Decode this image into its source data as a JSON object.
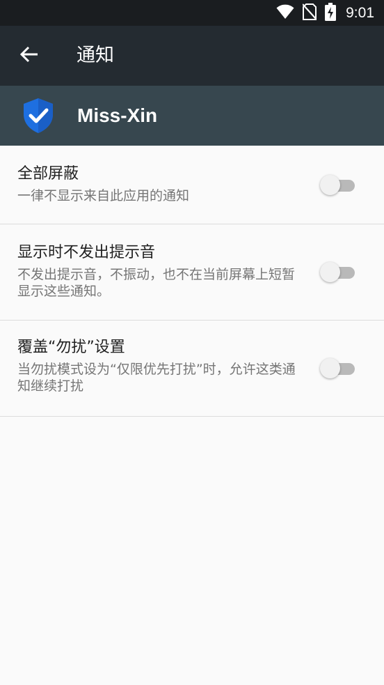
{
  "status_bar": {
    "time": "9:01",
    "icons": [
      "wifi-icon",
      "no-sim-icon",
      "battery-charging-icon"
    ]
  },
  "toolbar": {
    "back_icon": "arrow-left-icon",
    "title": "通知"
  },
  "app_header": {
    "icon": "shield-check-icon",
    "name": "Miss-Xin",
    "icon_color": "#1e6fe0"
  },
  "settings": [
    {
      "title": "全部屏蔽",
      "summary": "一律不显示来自此应用的通知",
      "enabled": false
    },
    {
      "title": "显示时不发出提示音",
      "summary": "不发出提示音，不振动，也不在当前屏幕上短暂显示这些通知。",
      "enabled": false
    },
    {
      "title": "覆盖“勿扰”设置",
      "summary": "当勿扰模式设为“仅限优先打扰”时，允许这类通知继续打扰",
      "enabled": false
    }
  ],
  "colors": {
    "status_bar": "#1a1d20",
    "toolbar": "#242b31",
    "app_header": "#37474f",
    "background": "#fafafa"
  }
}
